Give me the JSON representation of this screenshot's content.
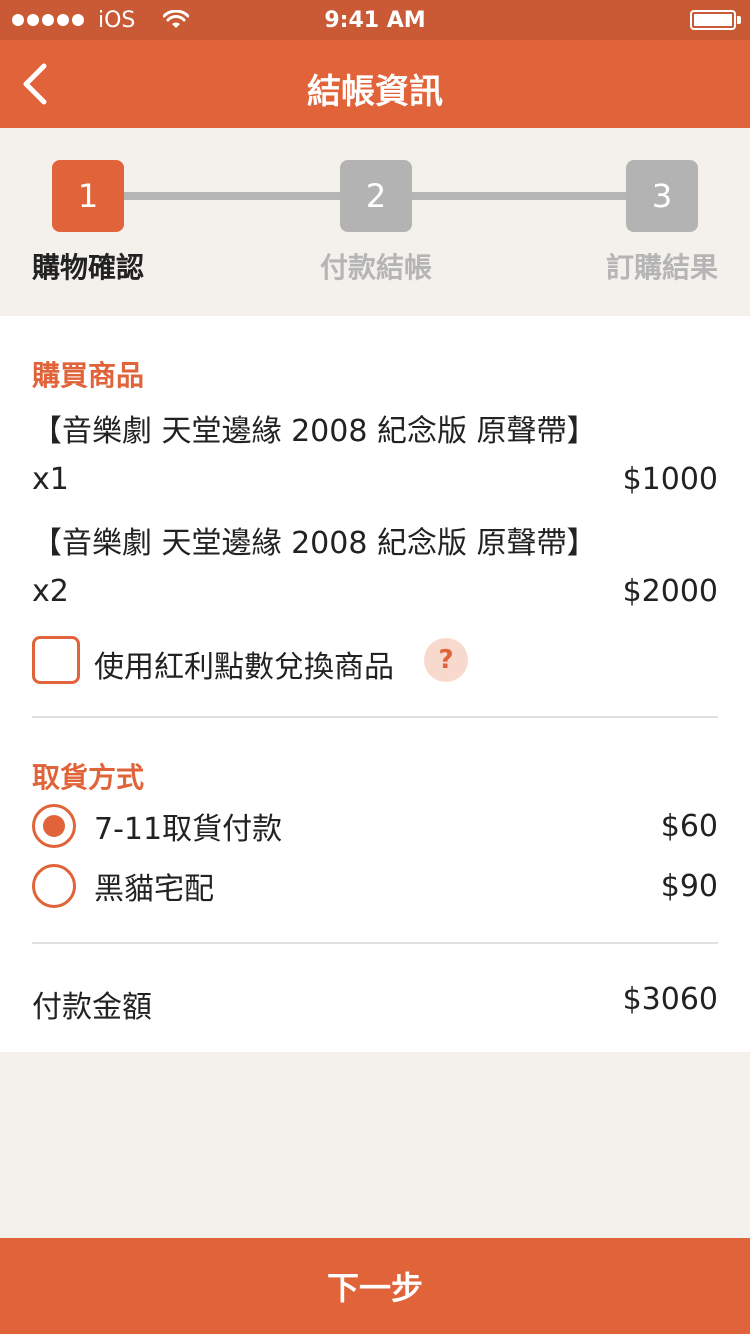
{
  "status_bar": {
    "carrier": "iOS",
    "time": "9:41 AM"
  },
  "nav": {
    "title": "結帳資訊",
    "back_icon": "chevron-left-icon"
  },
  "stepper": {
    "steps": [
      {
        "number": "1",
        "label": "購物確認",
        "active": true
      },
      {
        "number": "2",
        "label": "付款結帳",
        "active": false
      },
      {
        "number": "3",
        "label": "訂購結果",
        "active": false
      }
    ]
  },
  "products": {
    "title": "購買商品",
    "items": [
      {
        "name": "【音樂劇 天堂邊緣 2008 紀念版 原聲帶】",
        "qty": "x1",
        "price": "$1000"
      },
      {
        "name": "【音樂劇 天堂邊緣 2008 紀念版 原聲帶】",
        "qty": "x2",
        "price": "$2000"
      }
    ],
    "bonus_checkbox_label": "使用紅利點數兌換商品",
    "bonus_checked": false,
    "help_label": "?"
  },
  "delivery": {
    "title": "取貨方式",
    "options": [
      {
        "label": "7-11取貨付款",
        "price": "$60",
        "selected": true
      },
      {
        "label": "黑貓宅配",
        "price": "$90",
        "selected": false
      }
    ]
  },
  "payment": {
    "label": "付款金額",
    "amount": "$3060"
  },
  "footer": {
    "next_label": "下一步"
  },
  "colors": {
    "accent": "#e1633a",
    "status_bar": "#c95a35",
    "inactive_step": "#b3b3b3",
    "background": "#f4f1ec"
  }
}
